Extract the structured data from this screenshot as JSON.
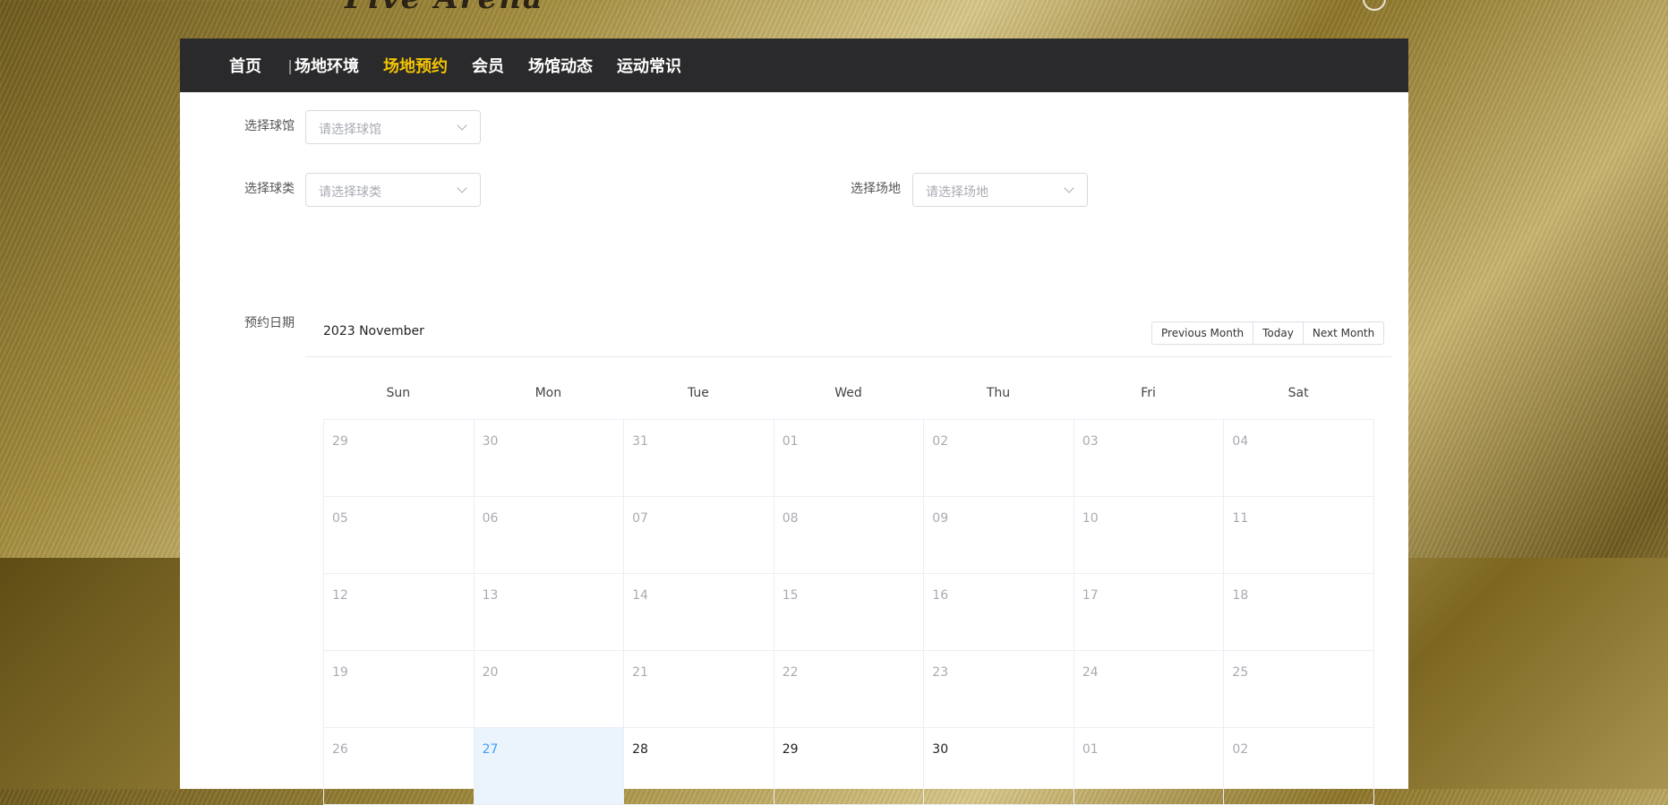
{
  "logo": "Five Arena",
  "nav": {
    "items": [
      {
        "label": "首页",
        "active": false
      },
      {
        "label": "场地环境",
        "active": false
      },
      {
        "label": "场地预约",
        "active": true
      },
      {
        "label": "会员",
        "active": false
      },
      {
        "label": "场馆动态",
        "active": false
      },
      {
        "label": "运动常识",
        "active": false
      }
    ]
  },
  "form": {
    "venue": {
      "label": "选择球馆",
      "placeholder": "请选择球馆"
    },
    "sport": {
      "label": "选择球类",
      "placeholder": "请选择球类"
    },
    "court": {
      "label": "选择场地",
      "placeholder": "请选择场地"
    },
    "date_label": "预约日期"
  },
  "calendar": {
    "title": "2023 November",
    "prev": "Previous Month",
    "today": "Today",
    "next": "Next Month",
    "weekdays": [
      "Sun",
      "Mon",
      "Tue",
      "Wed",
      "Thu",
      "Fri",
      "Sat"
    ],
    "weeks": [
      [
        "29",
        "30",
        "31",
        "01",
        "02",
        "03",
        "04"
      ],
      [
        "05",
        "06",
        "07",
        "08",
        "09",
        "10",
        "11"
      ],
      [
        "12",
        "13",
        "14",
        "15",
        "16",
        "17",
        "18"
      ],
      [
        "19",
        "20",
        "21",
        "22",
        "23",
        "24",
        "25"
      ],
      [
        "26",
        "27",
        "28",
        "29",
        "30",
        "01",
        "02"
      ]
    ],
    "states": [
      [
        "o",
        "o",
        "o",
        "o",
        "o",
        "o",
        "o"
      ],
      [
        "o",
        "o",
        "o",
        "o",
        "o",
        "o",
        "o"
      ],
      [
        "o",
        "o",
        "o",
        "o",
        "o",
        "o",
        "o"
      ],
      [
        "o",
        "o",
        "o",
        "o",
        "o",
        "o",
        "o"
      ],
      [
        "o",
        "s",
        "c",
        "c",
        "c",
        "o",
        "o"
      ]
    ]
  },
  "colors": {
    "accent": "#f5c400",
    "nav_bg": "#2a2a2c",
    "selected": "#409eff"
  }
}
